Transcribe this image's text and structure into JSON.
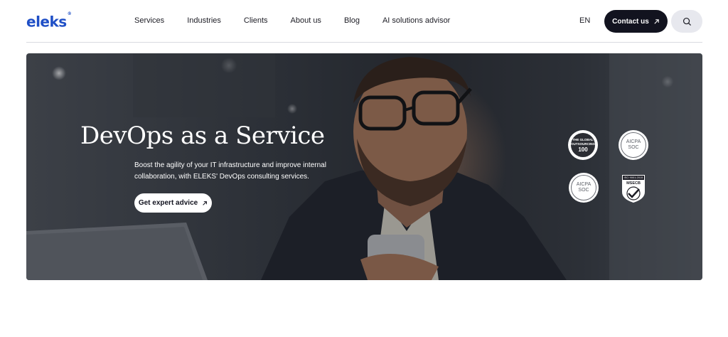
{
  "header": {
    "logo": "eleks",
    "logo_mark": "®",
    "nav": [
      {
        "label": "Services"
      },
      {
        "label": "Industries"
      },
      {
        "label": "Clients"
      },
      {
        "label": "About us"
      },
      {
        "label": "Blog"
      },
      {
        "label": "AI solutions advisor"
      }
    ],
    "language": "EN",
    "contact_label": "Contact us",
    "search_icon": "search-icon"
  },
  "hero": {
    "title": "DevOps as a Service",
    "description": "Boost the agility of your IT infrastructure and improve internal collaboration, with ELEKS' DevOps consulting services.",
    "cta_label": "Get expert advice",
    "badges": [
      {
        "name": "outsourcing-100-badge",
        "line1": "THE GLOBAL",
        "line2": "OUTSOURCING",
        "line3": "100"
      },
      {
        "name": "aicpa-soc-badge-1",
        "line1": "AICPA",
        "line2": "SOC"
      },
      {
        "name": "aicpa-soc-badge-2",
        "line1": "AICPA",
        "line2": "SOC"
      },
      {
        "name": "iso-mscb-badge",
        "line1": "ISO 9001:2015",
        "line2": "MSECB"
      }
    ]
  },
  "colors": {
    "brand_blue": "#1f4fc6",
    "dark_button": "#12131f",
    "search_button": "#e7e8ee"
  }
}
